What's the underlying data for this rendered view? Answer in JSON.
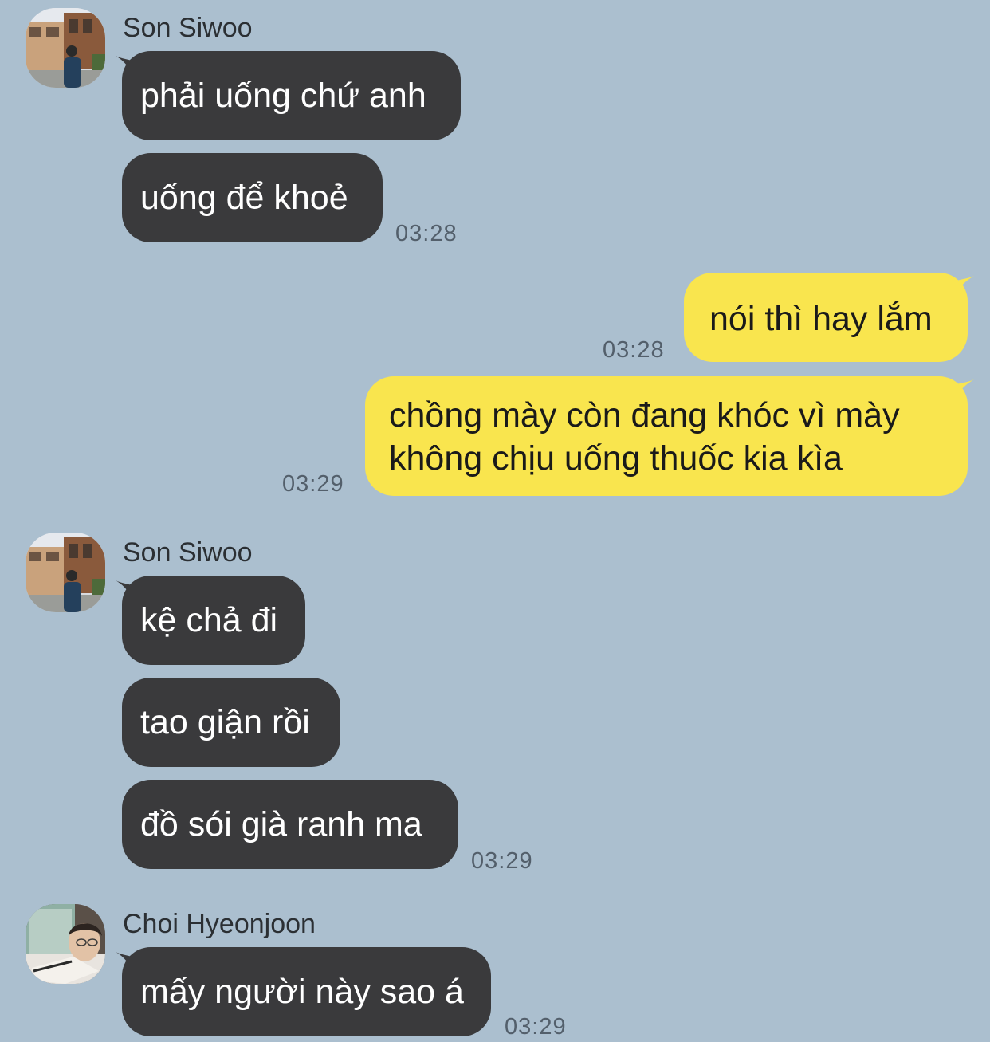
{
  "colors": {
    "background": "#abbfcf",
    "incoming_bubble": "#3a3a3c",
    "outgoing_bubble": "#f9e54e"
  },
  "messages": [
    {
      "sender": "Son Siwoo",
      "avatar": "profile-photo",
      "text": "phải uống chứ anh"
    },
    {
      "text": "uống để khoẻ",
      "time": "03:28"
    },
    {
      "outgoing": true,
      "text": "nói thì hay lắm",
      "time": "03:28"
    },
    {
      "outgoing": true,
      "lines": [
        "chồng mày còn đang khóc vì mày",
        "không chịu uống thuốc kia kìa"
      ],
      "time": "03:29"
    },
    {
      "sender": "Son Siwoo",
      "avatar": "profile-photo",
      "text": "kệ chả đi"
    },
    {
      "text": "tao giận rồi"
    },
    {
      "text": "đồ sói già ranh ma",
      "time": "03:29"
    },
    {
      "sender": "Choi Hyeonjoon",
      "avatar": "profile-photo",
      "text": "mấy người này sao á",
      "time": "03:29"
    }
  ]
}
